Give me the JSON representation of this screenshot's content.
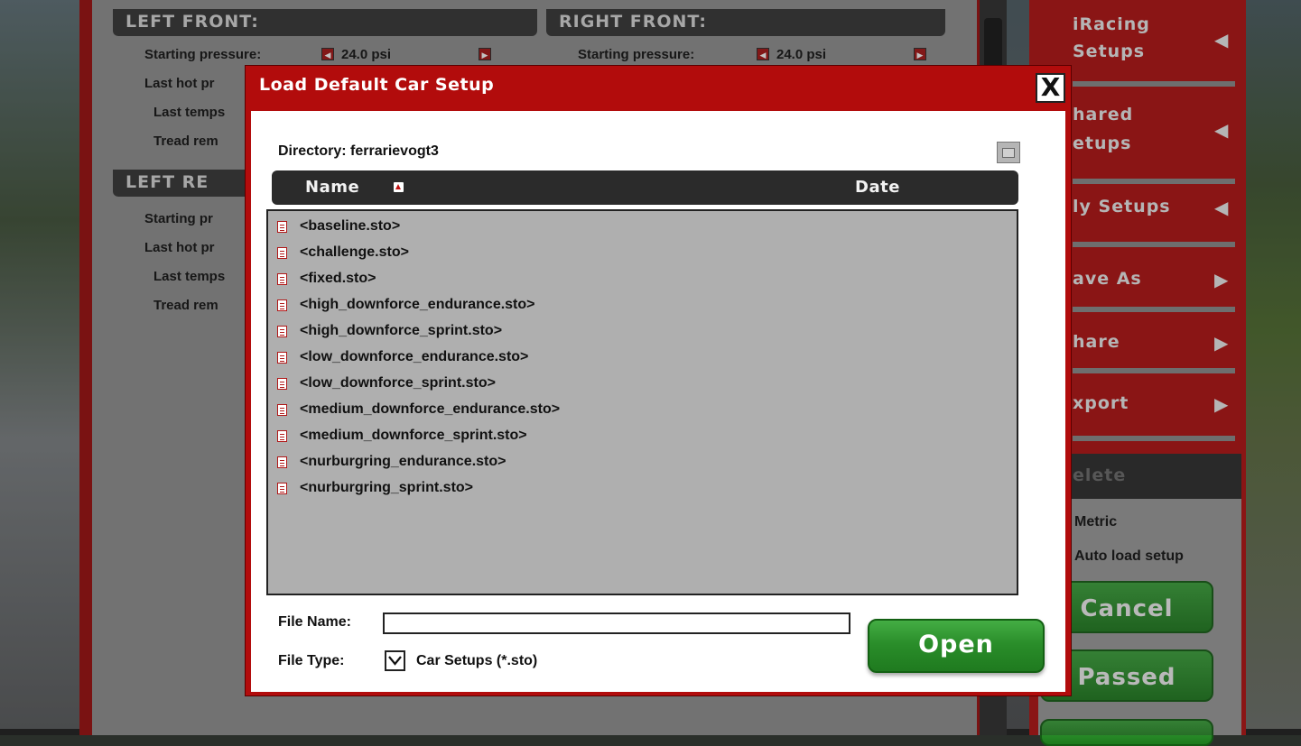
{
  "background": {
    "left_front": {
      "header": "LEFT FRONT:",
      "starting_pressure_label": "Starting pressure:",
      "starting_pressure_value": "24.0 psi",
      "last_hot_label": "Last hot pr",
      "last_temps_label": "Last temps",
      "tread_label": "Tread rem"
    },
    "right_front": {
      "header": "RIGHT FRONT:",
      "starting_pressure_label": "Starting pressure:",
      "starting_pressure_value": "24.0 psi"
    },
    "left_rear": {
      "header": "LEFT RE",
      "starting_pressure_label": "Starting pr",
      "last_hot_label": "Last hot pr",
      "last_temps_label": "Last temps",
      "tread_label": "Tread rem"
    },
    "sidebar": {
      "iracing_setups_line1": "iRacing",
      "iracing_setups_line2": "Setups",
      "shared_setups_line1": "hared",
      "shared_setups_line2": "etups",
      "my_setups": "ly Setups",
      "save_as": "ave As",
      "share": "hare",
      "export": "xport",
      "delete": "elete",
      "metric": "Metric",
      "auto_load": "Auto load setup",
      "cancel": "Cancel",
      "passed": "Passed"
    }
  },
  "dialog": {
    "title": "Load Default Car Setup",
    "close_label": "X",
    "directory_label": "Directory:",
    "directory_value": "ferrarievogt3",
    "columns": {
      "name": "Name",
      "date": "Date"
    },
    "files": [
      "<baseline.sto>",
      "<challenge.sto>",
      "<fixed.sto>",
      "<high_downforce_endurance.sto>",
      "<high_downforce_sprint.sto>",
      "<low_downforce_endurance.sto>",
      "<low_downforce_sprint.sto>",
      "<medium_downforce_endurance.sto>",
      "<medium_downforce_sprint.sto>",
      "<nurburgring_endurance.sto>",
      "<nurburgring_sprint.sto>"
    ],
    "file_name_label": "File Name:",
    "file_name_value": "",
    "file_type_label": "File Type:",
    "file_type_value": "Car Setups (*.sto)",
    "open_label": "Open"
  },
  "colors": {
    "accent_red": "#b20c0c",
    "open_green": "#2a8e2a",
    "list_bg": "#afafaf"
  }
}
